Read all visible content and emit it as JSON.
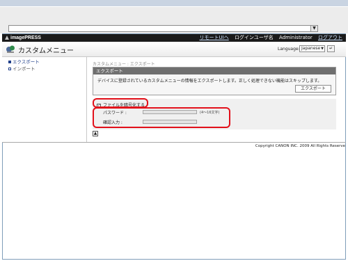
{
  "browser": {
    "address_value": "",
    "dropdown_glyph": "▼"
  },
  "brand": {
    "logo_text": "imagePRESS",
    "links": [
      "リモートUIへ",
      "ログインユーザ名",
      "Administrator",
      "ログアウト"
    ]
  },
  "header": {
    "title": "カスタムメニュー",
    "language_label": "Language:",
    "language_value": "Japanese",
    "language_go_glyph": "↵"
  },
  "sidebar": {
    "items": [
      {
        "label": "エクスポート",
        "active": true
      },
      {
        "label": "インポート",
        "active": false
      }
    ]
  },
  "main": {
    "breadcrumb": "カスタムメニュー : エクスポート",
    "export": {
      "heading": "エクスポート",
      "description": "デバイスに登録されているカスタムメニューの情報をエクスポートします。正しく処理できない機能はスキップします。",
      "button_label": "エクスポート"
    },
    "options": {
      "encrypt_label": "ファイルを暗号化する",
      "encrypt_checked": true,
      "password_label": "パスワード :",
      "password_hint": "(4～16文字)",
      "confirm_label": "確認入力 :"
    },
    "top_glyph": "▲"
  },
  "footer": {
    "copyright": "Copyright CANON INC. 2009 All Rights Reserve"
  },
  "colors": {
    "highlight": "#e2101a",
    "brand_bar": "#1a1a1a",
    "panel_head": "#6f6f6f",
    "active_link": "#1f3f8a"
  }
}
